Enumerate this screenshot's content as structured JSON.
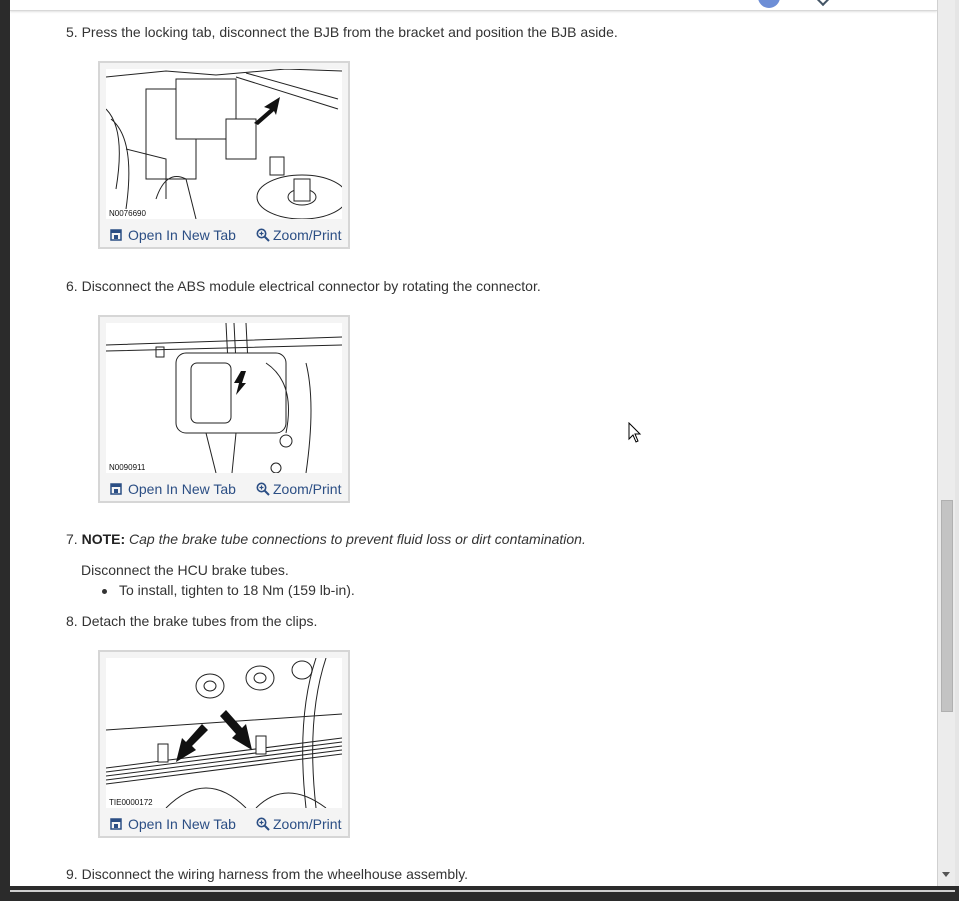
{
  "steps": [
    {
      "number": "5.",
      "text": "Press the locking tab, disconnect the BJB from the bracket and position the BJB aside."
    },
    {
      "number": "6.",
      "text": "Disconnect the ABS module electrical connector by rotating the connector."
    },
    {
      "number": "7.",
      "note_label": "NOTE:",
      "note_text": "Cap the brake tube connections to prevent fluid loss or dirt contamination.",
      "text": "Disconnect the HCU brake tubes.",
      "bullets": [
        "To install, tighten to 18 Nm (159 lb-in)."
      ]
    },
    {
      "number": "8.",
      "text": "Detach the brake tubes from the clips."
    },
    {
      "number": "9.",
      "text": "Disconnect the wiring harness from the wheelhouse assembly."
    }
  ],
  "figures": [
    {
      "code": "N0076690"
    },
    {
      "code": "N0090911"
    },
    {
      "code": "TIE0000172"
    }
  ],
  "links": {
    "open_new_tab": "Open In New Tab",
    "zoom_print": "Zoom/Print",
    "open_icon": "open-new-tab-icon",
    "zoom_icon": "zoom-icon"
  },
  "colors": {
    "link": "#2b4e84",
    "text": "#333333"
  }
}
